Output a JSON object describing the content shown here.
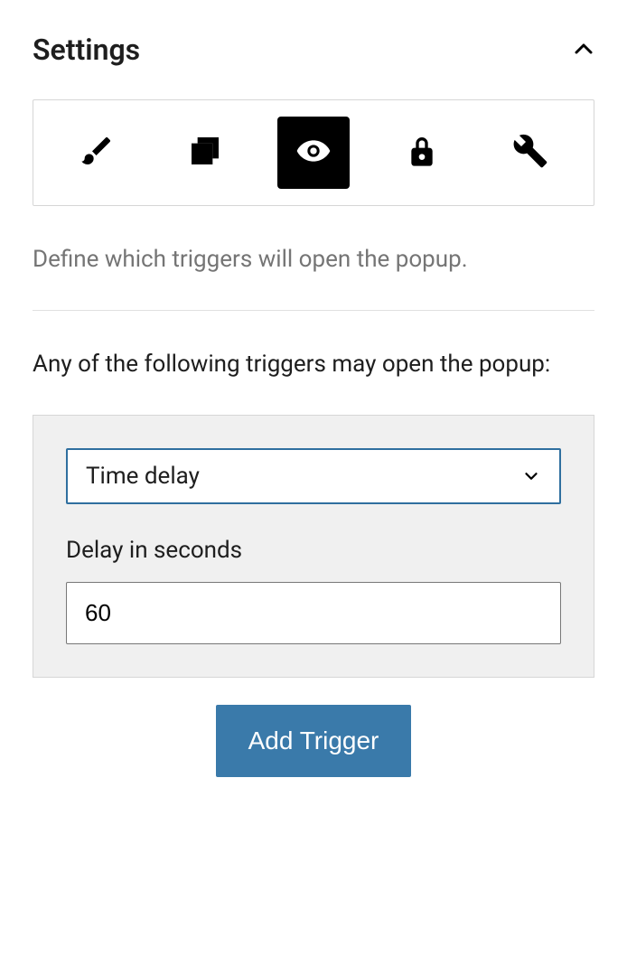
{
  "panel": {
    "title": "Settings"
  },
  "tabs": {
    "items": [
      {
        "name": "brush",
        "active": false
      },
      {
        "name": "layers",
        "active": false
      },
      {
        "name": "eye",
        "active": true
      },
      {
        "name": "lock",
        "active": false
      },
      {
        "name": "wrench",
        "active": false
      }
    ]
  },
  "description": "Define which triggers will open the popup.",
  "subtitle": "Any of the following triggers may open the popup:",
  "trigger": {
    "type_label": "Time delay",
    "delay_label": "Delay in seconds",
    "delay_value": "60"
  },
  "add_button": "Add Trigger"
}
